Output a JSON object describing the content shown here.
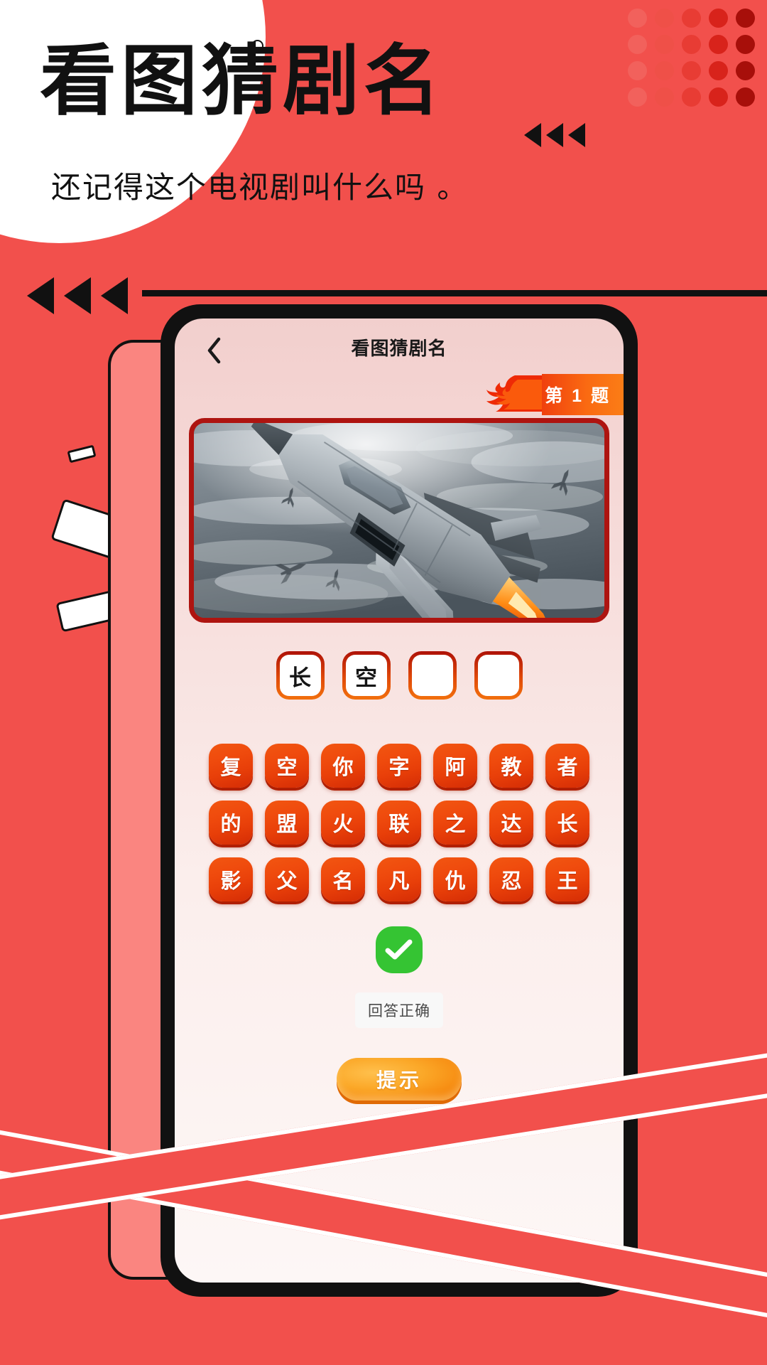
{
  "poster": {
    "title": "看图猜剧名",
    "subtitle": "还记得这个电视剧叫什么吗 。",
    "bg_color": "#f2504c",
    "accent_dark": "#111111"
  },
  "phone": {
    "nav": {
      "back_icon": "chevron-left-icon",
      "title": "看图猜剧名"
    },
    "question_badge": {
      "label": "第 1 题",
      "icon": "flame-icon",
      "color": "#f0400e"
    },
    "puzzle": {
      "alt": "fighter-jet-in-stormy-sky",
      "border_color": "#ae1410"
    },
    "answer_slots": [
      {
        "char": "长",
        "filled": true
      },
      {
        "char": "空",
        "filled": true
      },
      {
        "char": "",
        "filled": false
      },
      {
        "char": "",
        "filled": false
      }
    ],
    "keyboard_rows": [
      [
        "复",
        "空",
        "你",
        "字",
        "阿",
        "教",
        "者"
      ],
      [
        "的",
        "盟",
        "火",
        "联",
        "之",
        "达",
        "长"
      ],
      [
        "影",
        "父",
        "名",
        "凡",
        "仇",
        "忍",
        "王"
      ]
    ],
    "result": {
      "icon": "check-icon",
      "icon_color": "#35c433",
      "toast": "回答正确"
    },
    "hint_button": {
      "label": "提示",
      "color": "#fba828"
    }
  }
}
